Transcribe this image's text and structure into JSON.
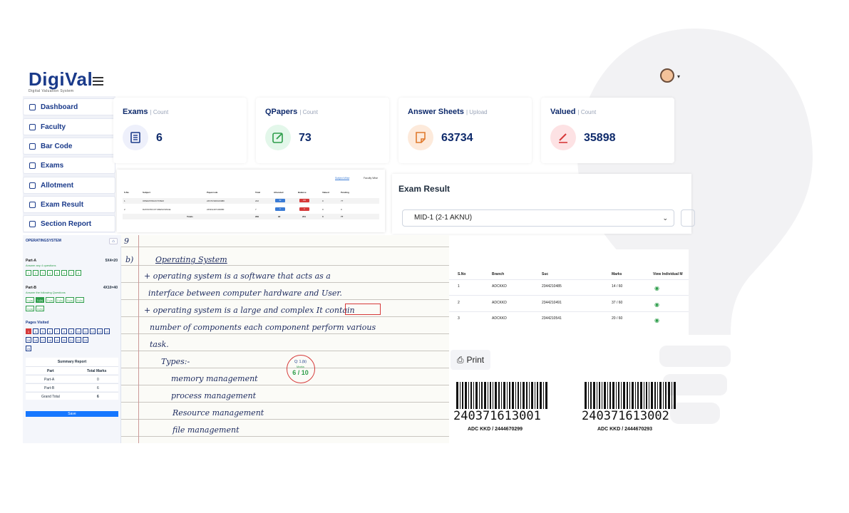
{
  "app": {
    "logo_text": "DigiVal",
    "logo_tagline": "Digital Valuation System"
  },
  "sidebar": {
    "items": [
      {
        "label": "Dashboard",
        "icon": "grid-icon"
      },
      {
        "label": "Faculty",
        "icon": "users-icon"
      },
      {
        "label": "Bar Code",
        "icon": "barcode-icon"
      },
      {
        "label": "Exams",
        "icon": "list-icon"
      },
      {
        "label": "Allotment",
        "icon": "allotment-icon"
      },
      {
        "label": "Exam Result",
        "icon": "result-icon"
      },
      {
        "label": "Section Report",
        "icon": "report-icon"
      }
    ]
  },
  "stats": [
    {
      "title": "Exams",
      "sub": "| Count",
      "value": "6",
      "color": "#eef0fb",
      "icon": "document-icon"
    },
    {
      "title": "QPapers",
      "sub": "| Count",
      "value": "73",
      "color": "#e3f7ea",
      "icon": "edit-icon"
    },
    {
      "title": "Answer Sheets",
      "sub": "| Upload",
      "value": "63734",
      "color": "#fdeadb",
      "icon": "sheet-icon"
    },
    {
      "title": "Valued",
      "sub": "| Count",
      "value": "35898",
      "color": "#fde2e4",
      "icon": "pen-icon"
    }
  ],
  "mini_table": {
    "tabs": [
      "Subject Wise",
      "Faculty Wise"
    ],
    "headers": [
      "S.No",
      "Subject",
      "Papercode",
      "Total",
      "Allocated",
      "Balance",
      "Valued",
      "Pending"
    ],
    "rows": [
      [
        "1",
        "OPERATINGSYSTEM",
        "24STCS6F103080",
        "222",
        "92",
        "130",
        "0",
        "77"
      ],
      [
        "2",
        "DATASTRUCTURESUSINGE",
        "24SFH407103080",
        "7",
        "0",
        "0",
        "0",
        "0"
      ]
    ],
    "totals": [
      "Totals",
      "299",
      "92",
      "231",
      "0",
      "77"
    ]
  },
  "exam_result": {
    "title": "Exam Result",
    "selected": "MID-1 (2-1 AKNU)"
  },
  "eval_panel": {
    "subject": "OPERATINGSYSTEM",
    "part_a": {
      "name": "Part-A",
      "marks": "5X4=20",
      "instruction": "Answer any 4 questions",
      "questions": [
        "1",
        "2",
        "3",
        "4",
        "5",
        "6",
        "7",
        "8"
      ]
    },
    "part_b": {
      "name": "Part-B",
      "marks": "4X10=40",
      "instruction": "Answer the following Questions",
      "questions": [
        "1.(a)",
        "1.(b)",
        "2.(a)",
        "2.(b)",
        "3.(a)",
        "3.(b)",
        "4.(a)",
        "4.(b)"
      ]
    },
    "pages_title": "Pages Visited",
    "pages": [
      "1",
      "4",
      "5",
      "6",
      "7",
      "8",
      "9",
      "10",
      "11",
      "12",
      "13",
      "14",
      "15",
      "16",
      "17",
      "18",
      "19",
      "20",
      "21",
      "22",
      "23",
      "24"
    ],
    "summary_title": "Summary Report",
    "summary_headers": [
      "Part",
      "Total Marks"
    ],
    "summary_rows": [
      [
        "Part-A",
        "0"
      ],
      [
        "Part-B",
        "6"
      ]
    ],
    "grand_total_label": "Grand Total",
    "grand_total_value": "6",
    "save_label": "Save"
  },
  "answer_sheet": {
    "lines": [
      "9",
      "b)",
      "Operating System",
      "+ operating system is a software that acts as a",
      "interface between computer hardware and User.",
      "+ operating system is a large and complex It contain",
      "number of components each component perform various",
      "task.",
      "Types:-",
      "memory management",
      "process management",
      "Resource management",
      "file management"
    ],
    "stamp_q": "Q: 1.(b)",
    "stamp_label": "Marks",
    "stamp_marks": "6 / 10"
  },
  "result_table": {
    "headers": [
      "S.No",
      "Branch",
      "Suc",
      "Marks",
      "View Individual M"
    ],
    "rows": [
      [
        "1",
        "ADCKKD",
        "2344210485",
        "14 / 60"
      ],
      [
        "2",
        "ADCKKD",
        "2344210491",
        "37 / 60"
      ],
      [
        "3",
        "ADCKKD",
        "2344210541",
        "20 / 60"
      ]
    ]
  },
  "print_label": "Print",
  "barcodes": [
    {
      "number": "240371613001",
      "sub": "ADC KKD / 2444670299"
    },
    {
      "number": "240371613002",
      "sub": "ADC KKD / 2444670293"
    }
  ]
}
